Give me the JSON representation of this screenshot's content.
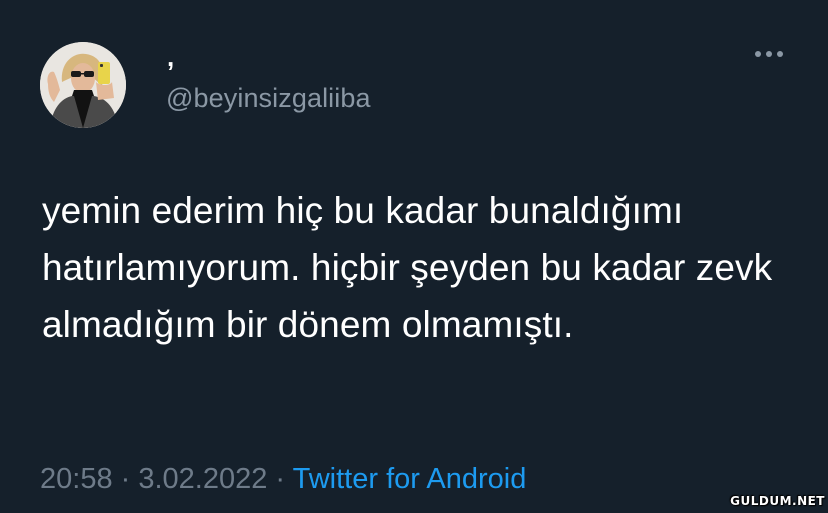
{
  "tweet": {
    "display_name": ",",
    "handle": "@beyinsizgaliiba",
    "text": "yemin ederim hiç bu kadar bunaldığımı hatırlamıyorum. hiçbir şeyden bu kadar zevk almadığım bir dönem olmamıştı.",
    "time": "20:58",
    "separator_1": " · ",
    "date": "3.02.2022",
    "separator_2": " · ",
    "source": "Twitter for Android",
    "more_icon": "more-horizontal-icon"
  },
  "watermark": {
    "text": "GULDUM.NET"
  },
  "colors": {
    "background": "#15202b",
    "text": "#ffffff",
    "secondary": "#8b98a5",
    "meta": "#6e7b89",
    "accent": "#1d9bf0"
  }
}
